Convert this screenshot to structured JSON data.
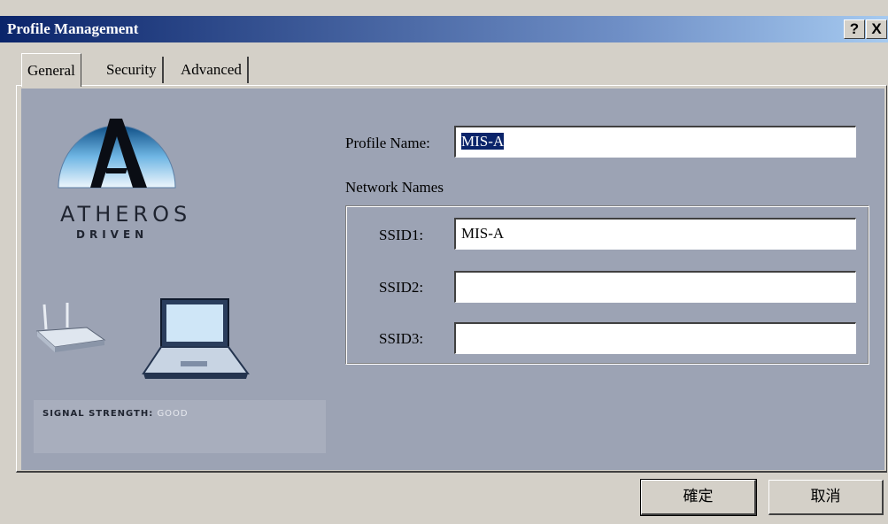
{
  "window": {
    "title": "Profile Management"
  },
  "title_buttons": {
    "help": "?",
    "close": "X"
  },
  "tabs": [
    {
      "label": "General"
    },
    {
      "label": "Security"
    },
    {
      "label": "Advanced"
    }
  ],
  "branding": {
    "name": "ATHEROS",
    "tagline": "DRIVEN",
    "signal_label": "SIGNAL STRENGTH:",
    "signal_value": "GOOD"
  },
  "form": {
    "profile_name_label": "Profile Name:",
    "profile_name_value": "MIS-A",
    "network_names_label": "Network Names",
    "ssids": [
      {
        "label": "SSID1:",
        "value": "MIS-A"
      },
      {
        "label": "SSID2:",
        "value": ""
      },
      {
        "label": "SSID3:",
        "value": ""
      }
    ]
  },
  "buttons": {
    "ok": "確定",
    "cancel": "取消"
  },
  "colors": {
    "titlebar_start": "#0a246a",
    "panel_bg": "#9ca3b4",
    "dialog_bg": "#d4d0c8"
  }
}
